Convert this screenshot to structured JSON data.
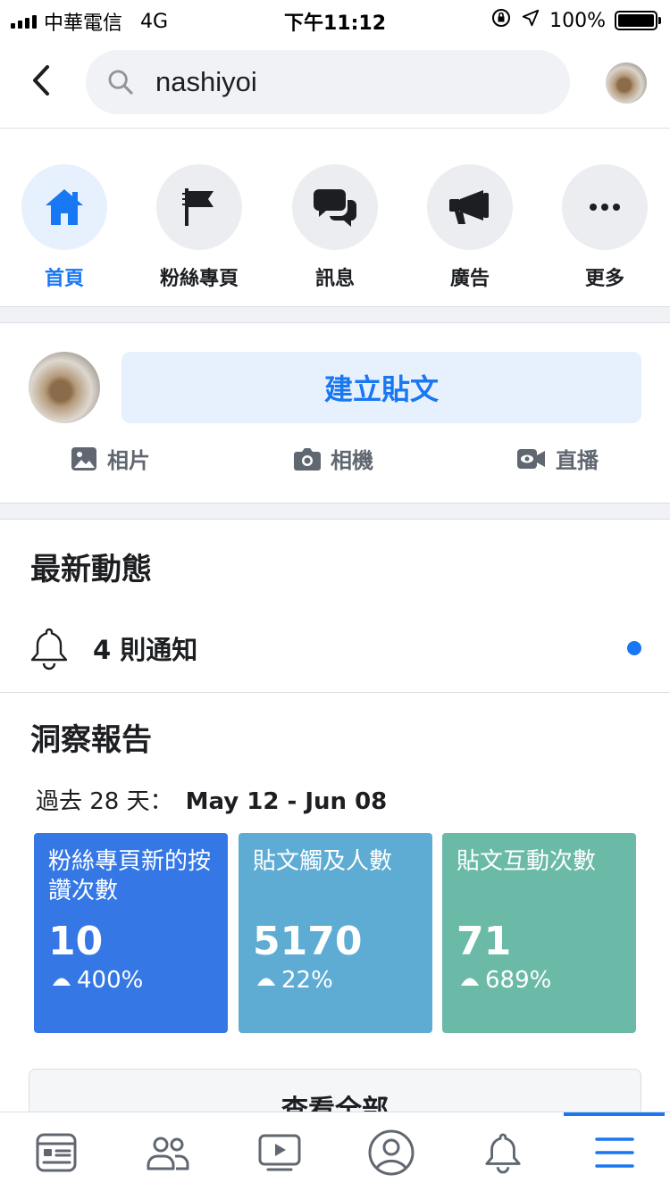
{
  "status_bar": {
    "carrier": "中華電信",
    "network": "4G",
    "time": "下午11:12",
    "battery": "100%",
    "battery_level": 1.0
  },
  "search": {
    "query": "nashiyoi",
    "icon": "search-icon"
  },
  "actions": [
    {
      "label": "首頁",
      "icon": "home-icon",
      "active": true
    },
    {
      "label": "粉絲專頁",
      "icon": "flag-icon",
      "active": false
    },
    {
      "label": "訊息",
      "icon": "chat-bubbles-icon",
      "active": false
    },
    {
      "label": "廣告",
      "icon": "megaphone-icon",
      "active": false
    },
    {
      "label": "更多",
      "icon": "more-icon",
      "active": false
    }
  ],
  "composer": {
    "create_post": "建立貼文",
    "photo": "相片",
    "camera": "相機",
    "live": "直播"
  },
  "latest": {
    "title": "最新動態",
    "notifications": "4 則通知"
  },
  "insights": {
    "title": "洞察報告",
    "period_label": "過去 28 天：",
    "date_range": "May 12 - Jun 08",
    "cards": [
      {
        "title": "粉絲專頁新的按讚次數",
        "value": "10",
        "change": "400%",
        "color": "#3578e5"
      },
      {
        "title": "貼文觸及人數",
        "value": "5170",
        "change": "22%",
        "color": "#5eacd3"
      },
      {
        "title": "貼文互動次數",
        "value": "71",
        "change": "689%",
        "color": "#6bbaa7"
      }
    ],
    "see_all": "查看全部"
  },
  "tab_bar": {
    "tabs": [
      "news-feed-icon",
      "friends-icon",
      "watch-icon",
      "profile-icon",
      "notifications-icon",
      "menu-icon"
    ],
    "active_index": 5,
    "accent": "#1877f2"
  }
}
